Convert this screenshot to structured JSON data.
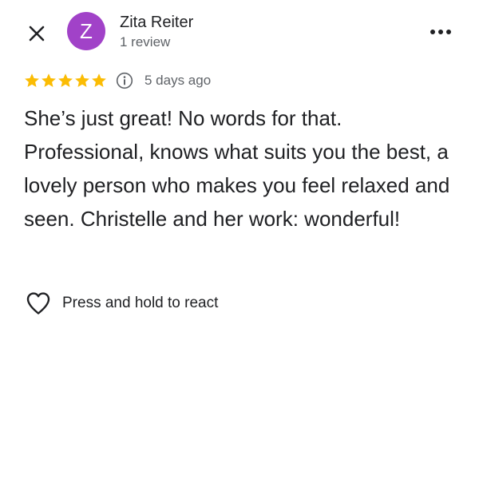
{
  "header": {
    "close_icon": "close-icon",
    "more_icon": "more-horizontal-icon"
  },
  "author": {
    "initial": "Z",
    "name": "Zita Reiter",
    "meta": "1 review",
    "avatar_color": "#a142c8"
  },
  "rating": {
    "stars": 5,
    "max_stars": 5,
    "star_color": "#fbbc04",
    "info_icon": "info-icon",
    "date": "5 days ago"
  },
  "review": {
    "text": "She’s just great! No words for that. Professional, knows what suits you the best, a lovely person who makes you feel relaxed and seen. Christelle and her work: wonderful!"
  },
  "reaction": {
    "icon": "heart-outline-icon",
    "label": "Press and hold to react"
  }
}
